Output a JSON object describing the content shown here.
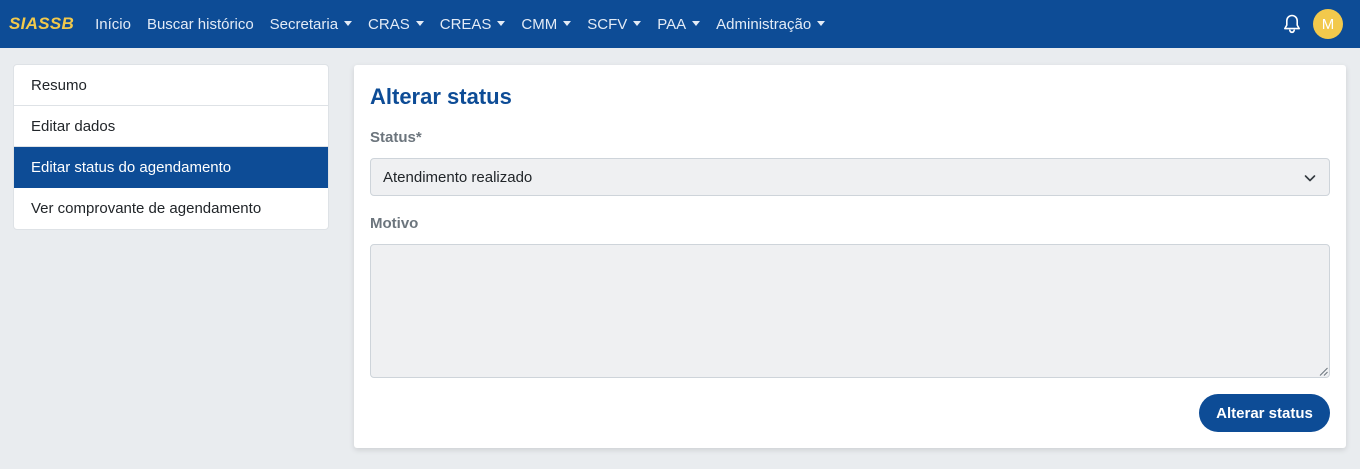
{
  "navbar": {
    "brand": "SIASSB",
    "items": [
      {
        "label": "Início",
        "dropdown": false
      },
      {
        "label": "Buscar histórico",
        "dropdown": false
      },
      {
        "label": "Secretaria",
        "dropdown": true
      },
      {
        "label": "CRAS",
        "dropdown": true
      },
      {
        "label": "CREAS",
        "dropdown": true
      },
      {
        "label": "CMM",
        "dropdown": true
      },
      {
        "label": "SCFV",
        "dropdown": true
      },
      {
        "label": "PAA",
        "dropdown": true
      },
      {
        "label": "Administração",
        "dropdown": true
      }
    ],
    "avatar_initial": "M",
    "icons": {
      "notifications": "bell-icon"
    }
  },
  "sidebar": {
    "items": [
      {
        "label": "Resumo",
        "active": false
      },
      {
        "label": "Editar dados",
        "active": false
      },
      {
        "label": "Editar status do agendamento",
        "active": true
      },
      {
        "label": "Ver comprovante de agendamento",
        "active": false
      }
    ]
  },
  "form": {
    "title": "Alterar status",
    "status_label": "Status*",
    "status_value": "Atendimento realizado",
    "motivo_label": "Motivo",
    "motivo_value": "",
    "submit_label": "Alterar status"
  },
  "colors": {
    "primary": "#0d4c96",
    "brand_accent": "#f2c94c",
    "background": "#e9ecef",
    "input_bg": "#eff0f2"
  }
}
